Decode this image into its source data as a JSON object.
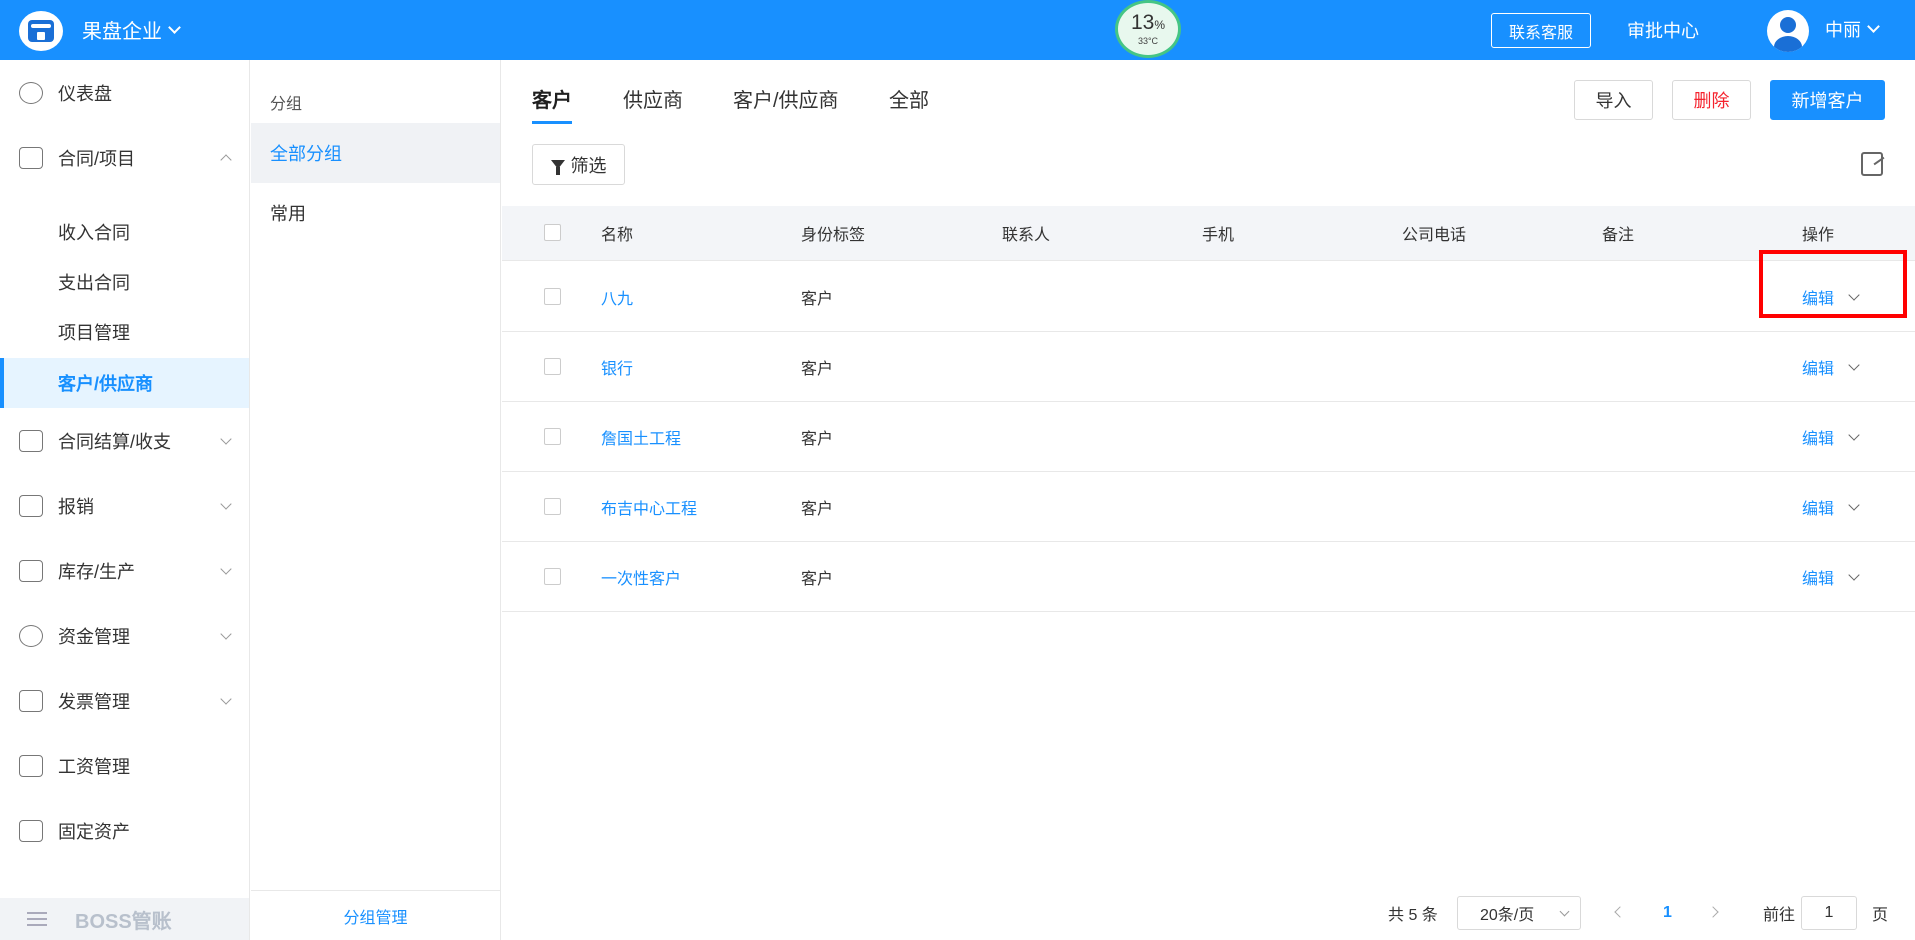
{
  "header": {
    "company": "果盘企业",
    "gauge_percent": "13",
    "gauge_percent_unit": "%",
    "gauge_temp": "33°C",
    "service_button": "联系客服",
    "approval_center": "审批中心",
    "user_name": "中丽",
    "brand_color": "#1890ff"
  },
  "sidebar": {
    "items": [
      {
        "label": "仪表盘"
      },
      {
        "label": "合同/项目"
      },
      {
        "label": "收入合同"
      },
      {
        "label": "支出合同"
      },
      {
        "label": "项目管理"
      },
      {
        "label": "客户/供应商"
      },
      {
        "label": "合同结算/收支"
      },
      {
        "label": "报销"
      },
      {
        "label": "库存/生产"
      },
      {
        "label": "资金管理"
      },
      {
        "label": "发票管理"
      },
      {
        "label": "工资管理"
      },
      {
        "label": "固定资产"
      }
    ],
    "footer": "BOSS管账"
  },
  "groups": {
    "header": "分组",
    "items": [
      {
        "label": "全部分组"
      },
      {
        "label": "常用"
      }
    ],
    "manage": "分组管理"
  },
  "tabs": [
    {
      "label": "客户"
    },
    {
      "label": "供应商"
    },
    {
      "label": "客户/供应商"
    },
    {
      "label": "全部"
    }
  ],
  "toolbar": {
    "import": "导入",
    "delete": "删除",
    "add": "新增客户",
    "filter": "筛选"
  },
  "table": {
    "columns": [
      "名称",
      "身份标签",
      "联系人",
      "手机",
      "公司电话",
      "备注",
      "操作"
    ],
    "rows": [
      {
        "name": "八九",
        "tag": "客户",
        "action": "编辑"
      },
      {
        "name": "银行",
        "tag": "客户",
        "action": "编辑"
      },
      {
        "name": "詹国土工程",
        "tag": "客户",
        "action": "编辑"
      },
      {
        "name": "布吉中心工程",
        "tag": "客户",
        "action": "编辑"
      },
      {
        "name": "一次性客户",
        "tag": "客户",
        "action": "编辑"
      }
    ]
  },
  "pagination": {
    "total": "共 5 条",
    "page_size": "20条/页",
    "current": "1",
    "goto_label": "前往",
    "goto_value": "1",
    "page_unit": "页"
  }
}
